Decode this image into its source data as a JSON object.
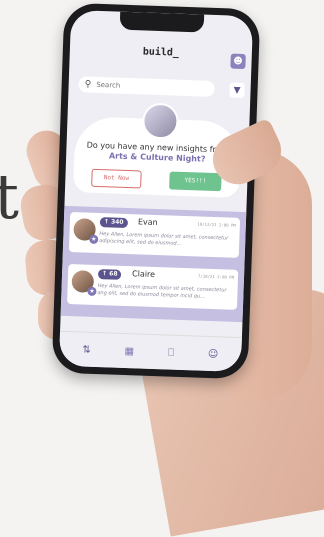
{
  "app": {
    "title": "build_"
  },
  "search": {
    "placeholder": "Search"
  },
  "insight": {
    "question": "Do you have any new insights from",
    "event": "Arts & Culture Night?",
    "no_label": "Not Now",
    "yes_label": "YES!!!"
  },
  "posts": [
    {
      "score": "340",
      "name": "Evan",
      "date": "10/13/21 2:00 PM",
      "text": "Hey Allen, Lorem ipsum dolor sit amet, consectetur adipiscing elit, sed do eiusmod..."
    },
    {
      "score": "68",
      "name": "Claire",
      "date": "7/10/21 2:00 PM",
      "text": "Hey Allen, Lorem ipsum dolor sit amet, consectetur ang elit, sed do eiusmod tempor incid qu..."
    }
  ],
  "icons": {
    "users": "users-icon",
    "search": "search-icon",
    "filter": "filter-icon",
    "nav": [
      "swap-icon",
      "community-icon",
      "chat-icon",
      "profile-icon"
    ]
  },
  "colors": {
    "accent": "#5b548e",
    "yes": "#6fc38e",
    "no": "#d86b6b",
    "feed_bg": "#c5bfe1"
  }
}
